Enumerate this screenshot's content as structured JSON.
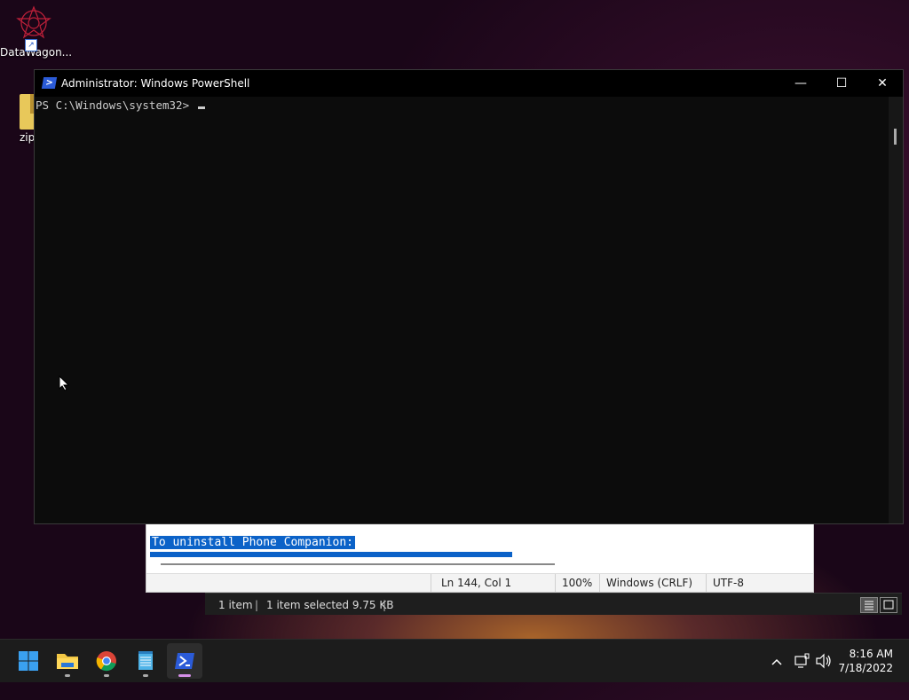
{
  "desktop": {
    "icons": [
      {
        "label": "DataWagon..."
      },
      {
        "label": "zip"
      }
    ]
  },
  "powershell": {
    "title": "Administrator: Windows PowerShell",
    "prompt": "PS C:\\Windows\\system32> ",
    "minimize": "—",
    "maximize": "☐",
    "close": "✕"
  },
  "notepad": {
    "selected_text": "To uninstall Phone Companion:",
    "status": {
      "position": "Ln 144, Col 1",
      "zoom": "100%",
      "line_endings": "Windows (CRLF)",
      "encoding": "UTF-8"
    }
  },
  "explorer": {
    "status": {
      "items": "1 item",
      "selected": "1 item selected  9.75 KB"
    }
  },
  "taskbar": {
    "apps": [
      "start",
      "file-explorer",
      "chrome",
      "notepad",
      "powershell"
    ],
    "clock": {
      "time": "8:16 AM",
      "date": "7/18/2022"
    }
  }
}
